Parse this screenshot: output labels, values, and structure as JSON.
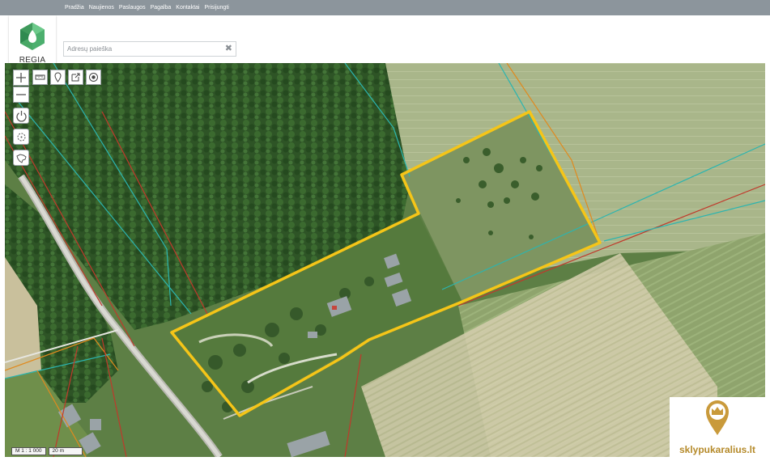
{
  "nav": {
    "items": [
      "Pradžia",
      "Naujienos",
      "Paslaugos",
      "Pagalba",
      "Kontaktai",
      "Prisijungti"
    ]
  },
  "logo": {
    "text": "REGIA"
  },
  "search": {
    "placeholder": "Adresų paieška",
    "value": "",
    "clear_icon": "close-icon"
  },
  "map": {
    "type": "orthophoto with cadastral parcel boundaries",
    "scale_text": "M 1 : 1 000",
    "scale_bar_label": "20 m",
    "colors": {
      "highlight_parcel": "#f5c518",
      "cadastral_line_red": "#c0392b",
      "cadastral_line_cyan": "#2bb5b0",
      "cadastral_line_orange": "#e08a1e"
    },
    "controls": [
      {
        "name": "zoom-in",
        "icon": "plus-icon"
      },
      {
        "name": "zoom-out",
        "icon": "minus-icon"
      },
      {
        "name": "measure",
        "icon": "ruler-icon"
      },
      {
        "name": "pin",
        "icon": "map-pin-icon"
      },
      {
        "name": "share",
        "icon": "external-link-icon"
      },
      {
        "name": "location",
        "icon": "target-icon"
      },
      {
        "name": "reset-view",
        "icon": "power-icon"
      },
      {
        "name": "gps",
        "icon": "crosshair-icon"
      },
      {
        "name": "full-extent",
        "icon": "lithuania-map-icon"
      }
    ]
  },
  "watermark": {
    "text": "sklypukaralius.lt",
    "icon": "crown-pin-icon"
  }
}
